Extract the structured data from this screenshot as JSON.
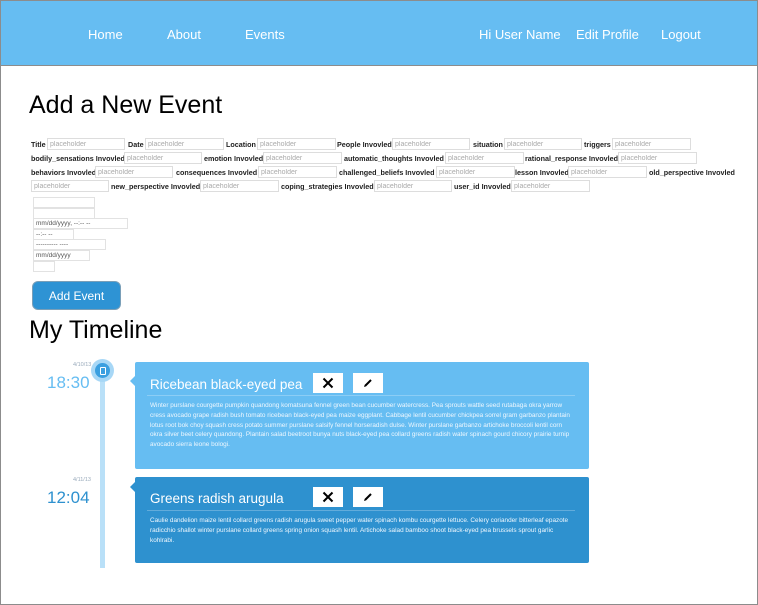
{
  "nav": {
    "left": [
      "Home",
      "About",
      "Events"
    ],
    "greeting": "Hi User Name",
    "edit_profile": "Edit Profile",
    "logout": "Logout",
    "bg_color": "#66bdf2"
  },
  "form": {
    "title": "Add a New Event",
    "placeholder": "placeholder",
    "fields": [
      {
        "label": "Title"
      },
      {
        "label": "Date"
      },
      {
        "label": "Location"
      },
      {
        "label": "People Invovled"
      },
      {
        "label": "situation"
      },
      {
        "label": "triggers"
      },
      {
        "label": "bodily_sensations Invovled"
      },
      {
        "label": "emotion Invovled"
      },
      {
        "label": "automatic_thoughts Invovled"
      },
      {
        "label": "rational_response Invovled"
      },
      {
        "label": "behaviors Invovled"
      },
      {
        "label": "consequences Invovled"
      },
      {
        "label": "challenged_beliefs Invovled"
      },
      {
        "label": "lesson Invovled"
      },
      {
        "label": "old_perspective Invovled"
      },
      {
        "label": "new_perspective Invovled"
      },
      {
        "label": "coping_strategies Invovled"
      },
      {
        "label": "user_id Invovled"
      }
    ],
    "extra_inputs": [
      "",
      "",
      "mm/dd/yyyy, --:-- --",
      "--:-- --",
      "---------- ----",
      "mm/dd/yyyy",
      ""
    ],
    "submit_label": "Add Event",
    "accent_color": "#2e93d4"
  },
  "timeline": {
    "title": "My Timeline",
    "events": [
      {
        "date": "4/10/13",
        "time": "18:30",
        "title": "Ricebean black-eyed pea",
        "body": "Winter purslane courgette pumpkin quandong komatsuna fennel green bean cucumber watercress. Pea sprouts wattle seed rutabaga okra yarrow cress avocado grape radish bush tomato ricebean black-eyed pea maize eggplant. Cabbage lentil cucumber chickpea sorrel gram garbanzo plantain lotus root bok choy squash cress potato summer purslane salsify fennel horseradish dulse. Winter purslane garbanzo artichoke broccoli lentil corn okra silver beet celery quandong. Plantain salad beetroot bunya nuts black-eyed pea collard greens radish water spinach gourd chicory prairie turnip avocado sierra leone bologi.",
        "color": "#66bdf2",
        "time_color": "#66bdf2"
      },
      {
        "date": "4/11/13",
        "time": "12:04",
        "title": "Greens radish arugula",
        "body": "Caulie dandelion maize lentil collard greens radish arugula sweet pepper water spinach kombu courgette lettuce. Celery coriander bitterleaf epazote radicchio shallot winter purslane collard greens spring onion squash lentil. Artichoke salad bamboo shoot black-eyed pea brussels sprout garlic kohlrabi.",
        "color": "#2e91cf",
        "time_color": "#2e91cf"
      }
    ],
    "delete_icon": "close-icon",
    "edit_icon": "pencil-icon"
  }
}
